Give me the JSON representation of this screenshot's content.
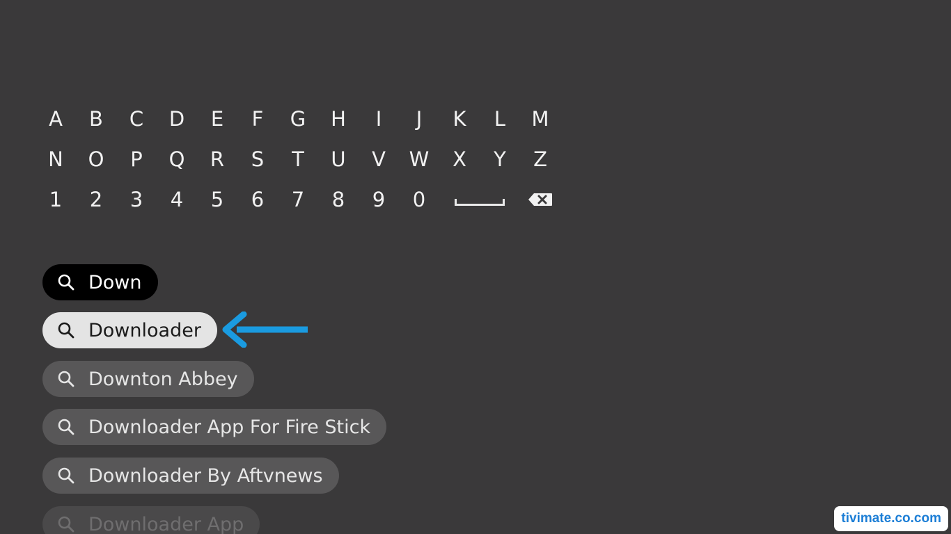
{
  "keyboard": {
    "rows": [
      [
        "A",
        "B",
        "C",
        "D",
        "E",
        "F",
        "G",
        "H",
        "I",
        "J",
        "K",
        "L",
        "M"
      ],
      [
        "N",
        "O",
        "P",
        "Q",
        "R",
        "S",
        "T",
        "U",
        "V",
        "W",
        "X",
        "Y",
        "Z"
      ],
      [
        "1",
        "2",
        "3",
        "4",
        "5",
        "6",
        "7",
        "8",
        "9",
        "0"
      ]
    ],
    "special_keys": [
      "space-bar-icon",
      "backspace-icon"
    ]
  },
  "search": {
    "query": "Down",
    "suggestions": [
      {
        "label": "Downloader",
        "state": "selected"
      },
      {
        "label": "Downton Abbey",
        "state": "normal"
      },
      {
        "label": "Downloader App For Fire Stick",
        "state": "normal"
      },
      {
        "label": "Downloader By Aftvnews",
        "state": "normal"
      },
      {
        "label": "Downloader App",
        "state": "faded"
      }
    ],
    "icon": "search-icon"
  },
  "annotation": {
    "icon": "arrow-left-icon",
    "color": "#1a9be0"
  },
  "watermark": {
    "text": "tivimate.co.com"
  },
  "colors": {
    "background": "#3a393a",
    "query_chip": "#000000",
    "selected_chip": "#e4e4e4",
    "normal_chip": "#585758"
  }
}
